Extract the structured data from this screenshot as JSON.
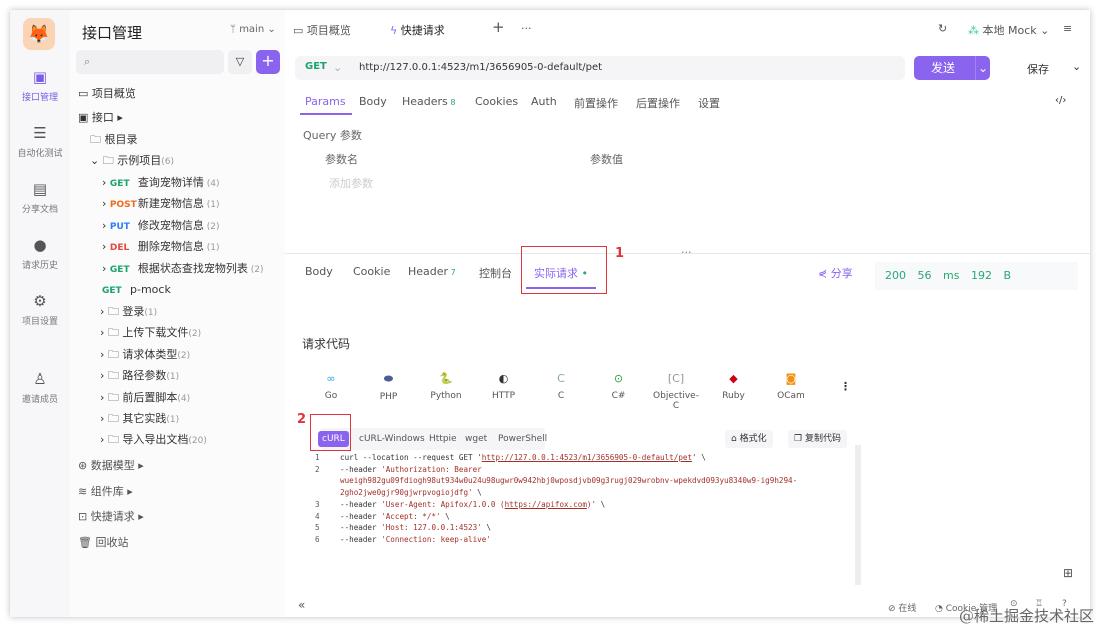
{
  "rail": {
    "items": [
      {
        "label": "接口管理",
        "icon": "api-icon"
      },
      {
        "label": "自动化测试",
        "icon": "test-icon"
      },
      {
        "label": "分享文档",
        "icon": "doc-icon"
      },
      {
        "label": "请求历史",
        "icon": "history-icon"
      },
      {
        "label": "项目设置",
        "icon": "settings-icon"
      },
      {
        "label": "邀请成员",
        "icon": "invite-icon"
      }
    ]
  },
  "sidebar": {
    "title": "接口管理",
    "branch": "main",
    "overview": "项目概览",
    "api": "接口",
    "root": "根目录",
    "project": {
      "name": "示例项目",
      "count": "(6)"
    },
    "endpoints": [
      {
        "method": "GET",
        "name": "查询宠物详情",
        "count": "(4)"
      },
      {
        "method": "POST",
        "name": "新建宠物信息",
        "count": "(1)"
      },
      {
        "method": "PUT",
        "name": "修改宠物信息",
        "count": "(2)"
      },
      {
        "method": "DEL",
        "name": "删除宠物信息",
        "count": "(1)"
      },
      {
        "method": "GET",
        "name": "根据状态查找宠物列表",
        "count": "(2)"
      },
      {
        "method": "GET",
        "name": "p-mock",
        "count": ""
      }
    ],
    "folders": [
      {
        "name": "登录",
        "count": "(1)"
      },
      {
        "name": "上传下载文件",
        "count": "(2)"
      },
      {
        "name": "请求体类型",
        "count": "(2)"
      },
      {
        "name": "路径参数",
        "count": "(1)"
      },
      {
        "name": "前后置脚本",
        "count": "(4)"
      },
      {
        "name": "其它实践",
        "count": "(1)"
      },
      {
        "name": "导入导出文档",
        "count": "(20)"
      }
    ],
    "bottom": [
      "数据模型",
      "组件库",
      "快捷请求",
      "回收站"
    ]
  },
  "tabs": {
    "overview": "项目概览",
    "quick": "快捷请求",
    "env": "本地 Mock"
  },
  "request": {
    "method": "GET",
    "url": "http://127.0.0.1:4523/m1/3656905-0-default/pet",
    "send": "发送",
    "save": "保存",
    "tabs": [
      "Params",
      "Body",
      "Headers",
      "Cookies",
      "Auth",
      "前置操作",
      "后置操作",
      "设置"
    ],
    "headers_count": "8",
    "query_label": "Query 参数",
    "col_name": "参数名",
    "col_value": "参数值",
    "add_param": "添加参数"
  },
  "response": {
    "tabs": [
      "Body",
      "Cookie",
      "Header",
      "控制台",
      "实际请求"
    ],
    "header_count": "7",
    "share": "分享",
    "status": "200",
    "time": "56 ms",
    "size": "192 B"
  },
  "code": {
    "title": "请求代码",
    "languages": [
      "Go",
      "PHP",
      "Python",
      "HTTP",
      "C",
      "C#",
      "Objective-C",
      "Ruby",
      "OCam"
    ],
    "variants": [
      "cURL",
      "cURL-Windows",
      "Httpie",
      "wget",
      "PowerShell"
    ],
    "format": "格式化",
    "copy": "复制代码",
    "lines": [
      {
        "n": "1",
        "pre": "curl --location --request GET '",
        "link": "http://127.0.0.1:4523/m1/3656905-0-default/pet",
        "post": "' \\"
      },
      {
        "n": "2",
        "pre": "--header ",
        "str": "'Authorization: Bearer"
      },
      {
        "n": "",
        "str": "wueigh982gu09fdiogh98ut934w0u24u98ugwr0w942hbj0wposdjvb09g3rugj029wrobnv-wpekdvd093yu8340w9-ig9h294-"
      },
      {
        "n": "",
        "str": "2gho2jwe0gjr90gjwrpvogiojdfg'",
        "post": " \\"
      },
      {
        "n": "3",
        "pre": "--header ",
        "str": "'User-Agent: Apifox/1.0.0 (",
        "link": "https://apifox.com",
        "str2": ")'",
        "post": " \\"
      },
      {
        "n": "4",
        "pre": "--header ",
        "str": "'Accept: */*'",
        "post": " \\"
      },
      {
        "n": "5",
        "pre": "--header ",
        "str": "'Host: 127.0.0.1:4523'",
        "post": " \\"
      },
      {
        "n": "6",
        "pre": "--header ",
        "str": "'Connection: keep-alive'"
      }
    ]
  },
  "footer": {
    "online": "在线",
    "cookie": "Cookie 管理"
  },
  "annotations": [
    "1",
    "2"
  ],
  "watermark": "@稀土掘金技术社区",
  "colors": {
    "accent": "#8a63ee",
    "get": "#1aa36b",
    "post": "#f06a1d",
    "put": "#2f7ef5",
    "del": "#e5483e",
    "annotation": "#e0353b"
  }
}
